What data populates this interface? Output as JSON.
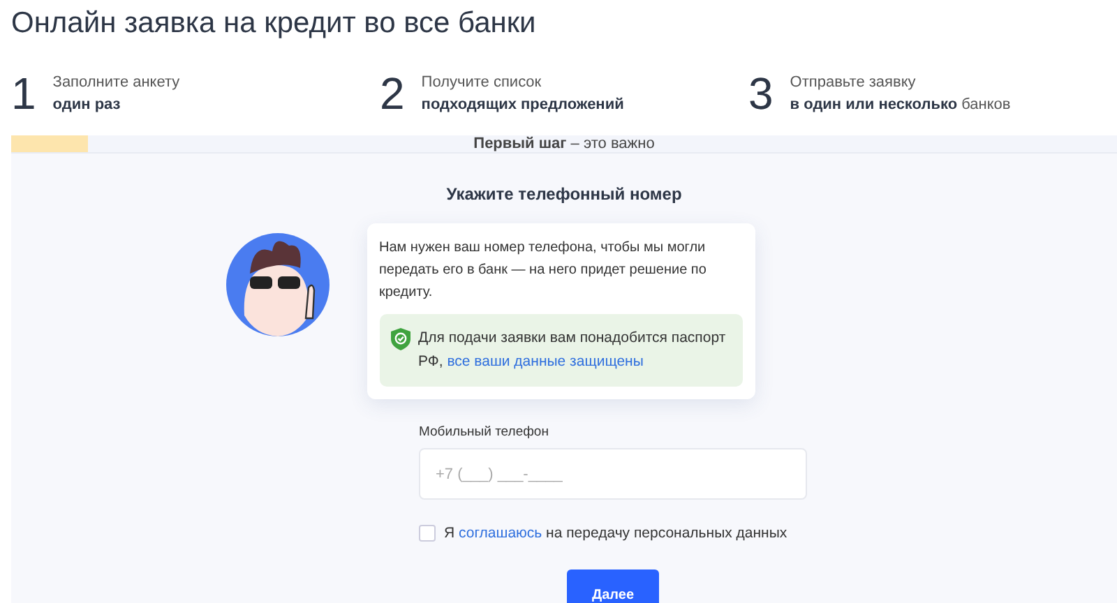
{
  "title": "Онлайн заявка на кредит во все банки",
  "steps": [
    {
      "number": "1",
      "line1": "Заполните анкету",
      "line2": "**один раз**"
    },
    {
      "number": "2",
      "line1": "Получите список",
      "line2": "**подходящих предложений**"
    },
    {
      "number": "3",
      "line1": "Отправьте заявку",
      "line2": "**в один или несколько** банков"
    }
  ],
  "progress": {
    "level": 0.07,
    "label": "**Первый шаг** – это важно"
  },
  "form": {
    "heading": "Укажите телефонный номер",
    "info": "Нам нужен ваш номер телефона, чтобы мы могли передать его в банк — на него придет решение по кредиту.",
    "note": {
      "text": "Для подачи заявки вам понадобится паспорт РФ,",
      "link": "все ваши данные защищены"
    },
    "phone": {
      "label": "Мобильный телефон",
      "placeholder": "+7 (___) ___-____"
    },
    "consent": {
      "checked": false,
      "prefix": "Я",
      "link": "соглашаюсь",
      "suffix": "на передачу персональных данных"
    },
    "button": "Далее"
  }
}
